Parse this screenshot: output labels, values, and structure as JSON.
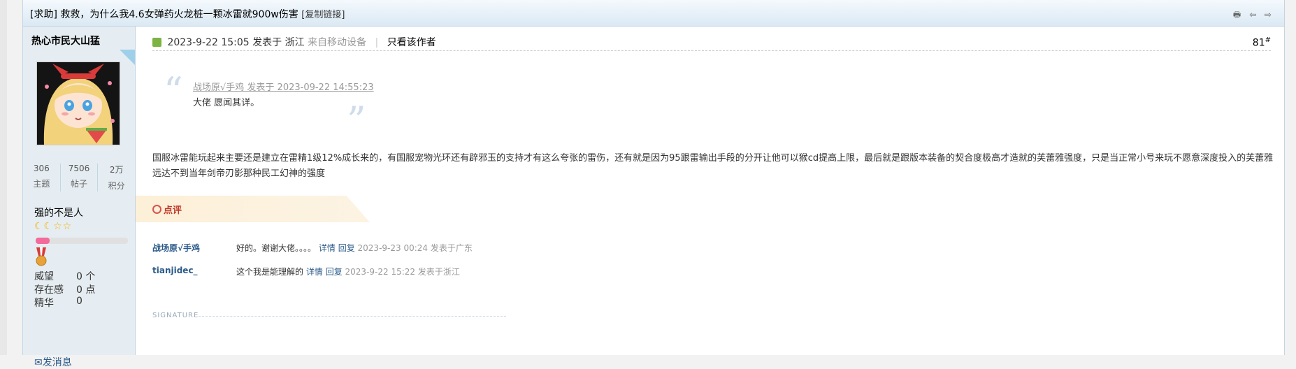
{
  "thread": {
    "title": "[求助] 救救，为什么我4.6女弹药火龙桩一颗冰雷就900w伤害",
    "copy_link": "[复制链接]",
    "tools": "🖶 ⇦ ⇨"
  },
  "author": {
    "name": "热心市民大山猛",
    "stats": [
      {
        "value": "306",
        "label": "主题"
      },
      {
        "value": "7506",
        "label": "帖子"
      },
      {
        "value": "2万",
        "label": "积分"
      }
    ],
    "rank_title": "强的不是人",
    "stars": "☾☾☆☆",
    "progress": 0.15,
    "fields": [
      {
        "label": "威望",
        "value": "0 个"
      },
      {
        "label": "存在感",
        "value": "0 点"
      },
      {
        "label": "精华",
        "value": "0"
      }
    ],
    "send_message": "✉发消息"
  },
  "post": {
    "date": "2023-9-22 15:05",
    "posted_in": "发表于 浙江",
    "device": "来自移动设备",
    "only_author": "只看该作者",
    "floor": "81",
    "floor_sup": "#",
    "quote": {
      "open_mark": "“",
      "close_mark": "”",
      "header": "战场原√手鸡 发表于 2023-09-22 14:55:23",
      "body": "大佬 愿闻其详。"
    },
    "content": "国服冰雷能玩起来主要还是建立在雷精1级12%成长来的，有国服宠物光环还有辟邪玉的支持才有这么夸张的雷伤，还有就是因为95跟雷输出手段的分开让他可以猴cd提高上限，最后就是跟版本装备的契合度极高才造就的芙蕾雅强度，只是当正常小号来玩不愿意深度投入的芙蕾雅远达不到当年剑帝刃影那种民工幻神的强度"
  },
  "comments": {
    "header": "点评",
    "items": [
      {
        "author": "战场原√手鸡",
        "text": "好的。谢谢大佬。。。。",
        "detail": "详情",
        "reply": "回复",
        "time": "2023-9-23 00:24 发表于广东"
      },
      {
        "author": "tianjidec_",
        "text": "这个我是能理解的",
        "detail": "详情",
        "reply": "回复",
        "time": "2023-9-22 15:22 发表于浙江"
      }
    ]
  },
  "signature_label": "SIGNATURE"
}
